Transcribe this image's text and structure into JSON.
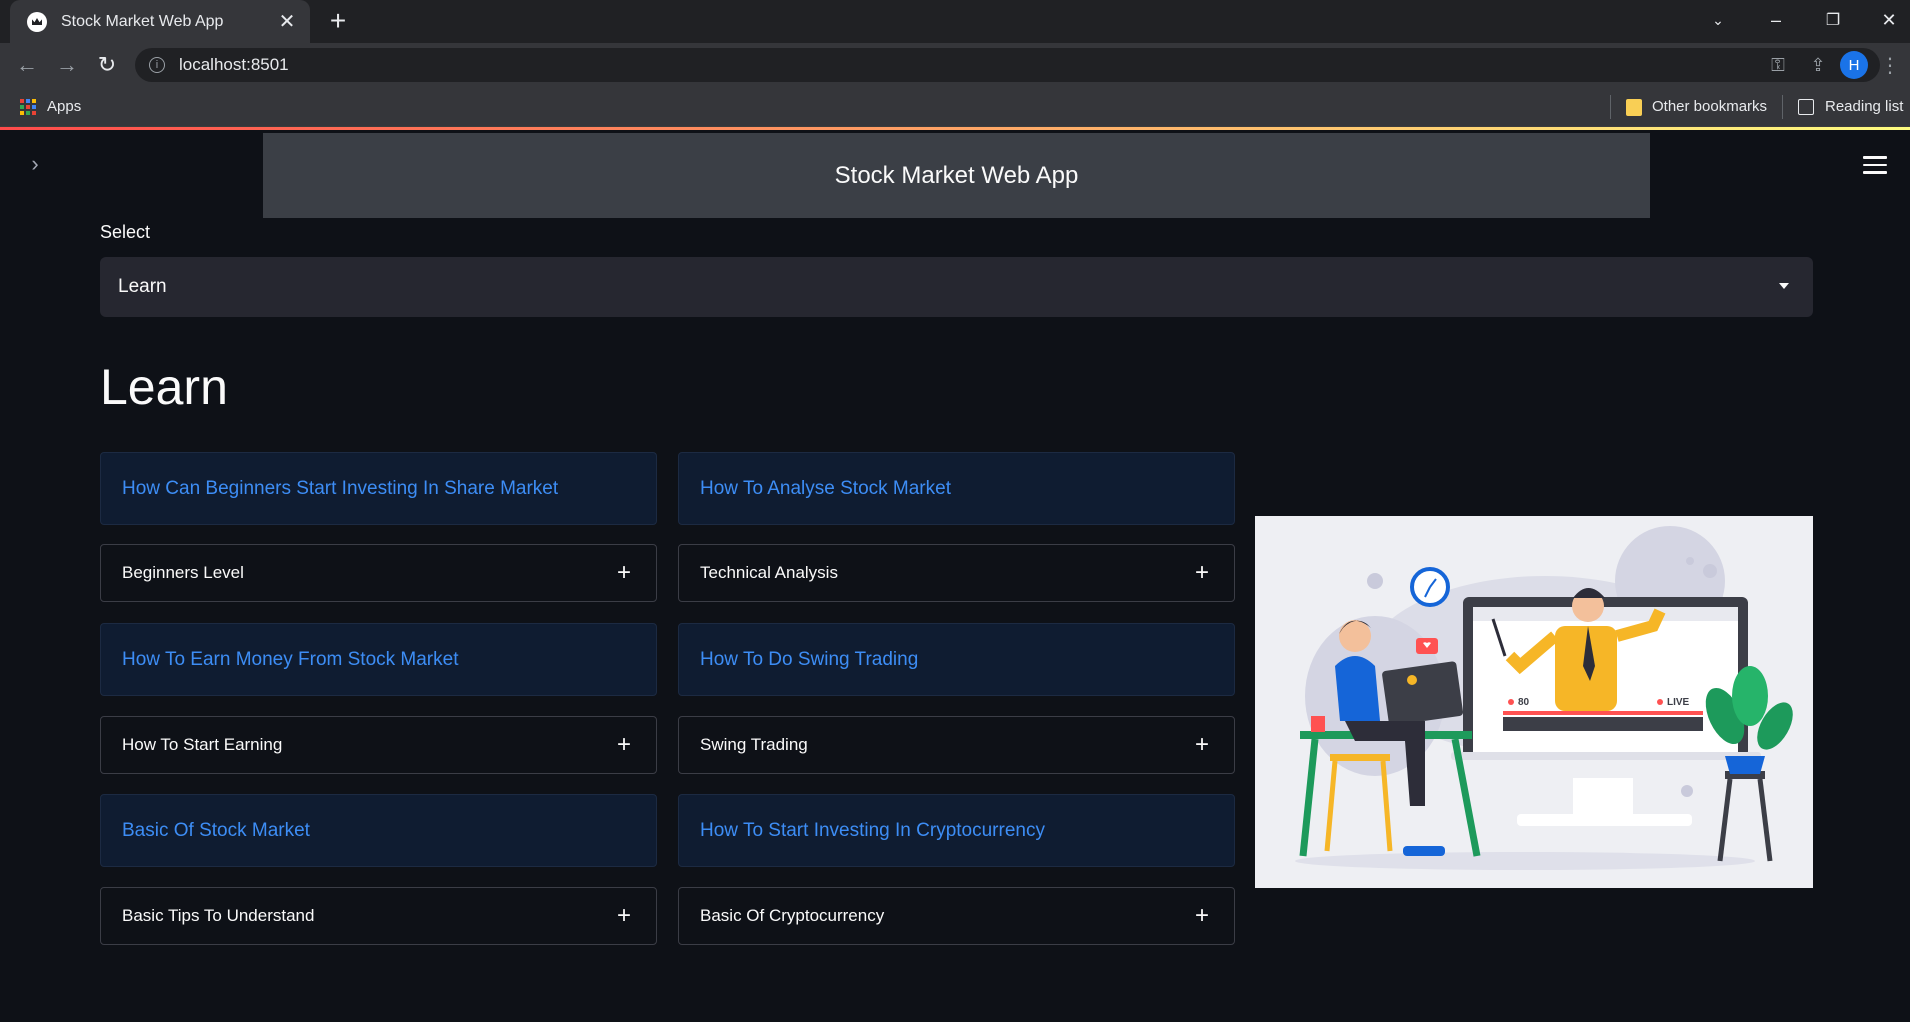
{
  "browser": {
    "tab_title": "Stock Market Web App",
    "url": "localhost:8501",
    "bookmarks": {
      "apps": "Apps",
      "other": "Other bookmarks",
      "reading_list": "Reading list"
    },
    "profile_initial": "H"
  },
  "app": {
    "header_title": "Stock Market Web App",
    "select": {
      "label": "Select",
      "value": "Learn"
    },
    "page_title": "Learn",
    "columns": [
      {
        "sections": [
          {
            "info": "How Can Beginners Start Investing In Share Market",
            "expander": "Beginners Level"
          },
          {
            "info": "How To Earn Money From Stock Market",
            "expander": "How To Start Earning"
          },
          {
            "info": "Basic Of Stock Market",
            "expander": "Basic Tips To Understand"
          }
        ]
      },
      {
        "sections": [
          {
            "info": "How To Analyse Stock Market",
            "expander": "Technical Analysis"
          },
          {
            "info": "How To Do Swing Trading",
            "expander": "Swing Trading"
          },
          {
            "info": "How To Start Investing In Cryptocurrency",
            "expander": "Basic Of Cryptocurrency"
          }
        ]
      }
    ],
    "illustration": {
      "viewer_count": "80",
      "live_label": "LIVE"
    }
  },
  "colors": {
    "background": "#0e1117",
    "info_text": "#3d8df5",
    "banner": "#3b3f46"
  }
}
